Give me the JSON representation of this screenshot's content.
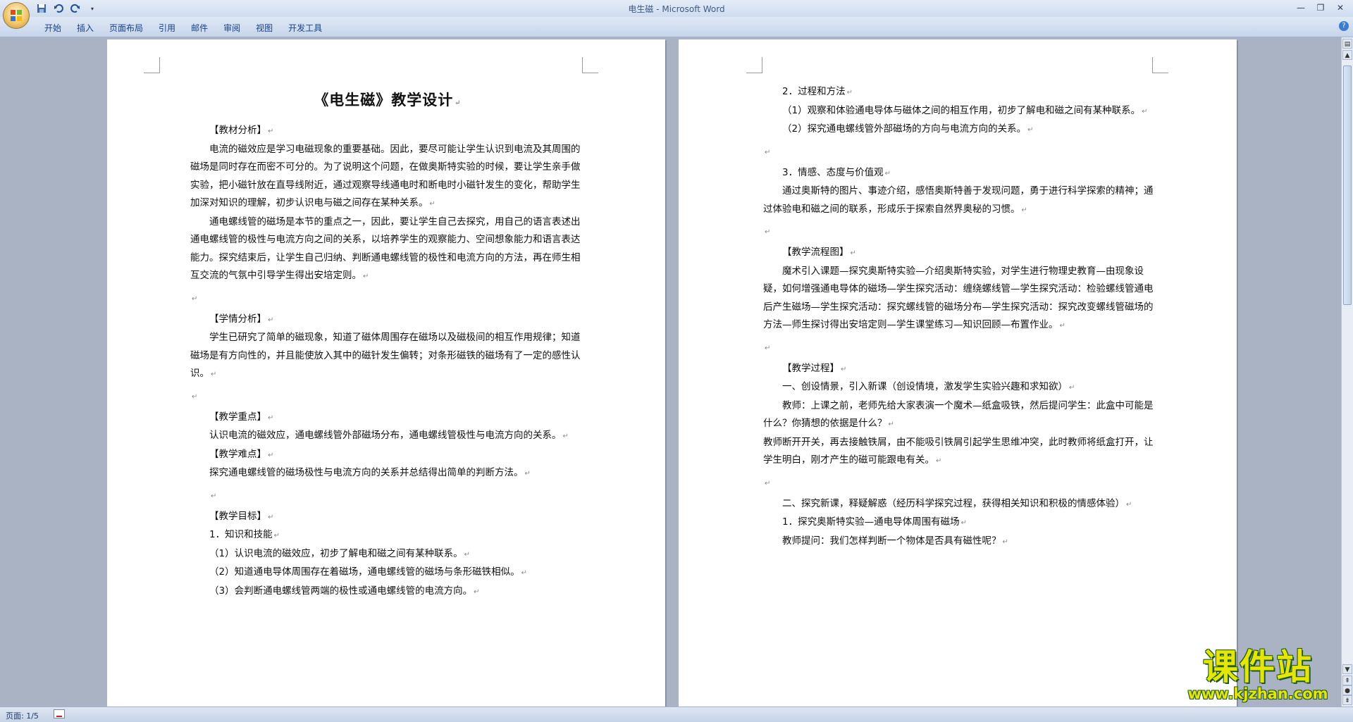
{
  "window": {
    "doc_name": "电生磁",
    "app_name": "Microsoft Word",
    "separator": " - "
  },
  "ribbon": {
    "tabs": [
      "开始",
      "插入",
      "页面布局",
      "引用",
      "邮件",
      "审阅",
      "视图",
      "开发工具"
    ]
  },
  "icons": {
    "office_button": "office-logo-icon",
    "save": "save-icon",
    "undo": "undo-icon",
    "redo": "redo-icon",
    "customize": "qat-dropdown-icon",
    "help": "help-icon"
  },
  "page1": {
    "title": "《电生磁》教学设计",
    "h_material": "【教材分析】",
    "p_material_1": "电流的磁效应是学习电磁现象的重要基础。因此，要尽可能让学生认识到电流及其周围的磁场是同时存在而密不可分的。为了说明这个问题，在做奥斯特实验的时候，要让学生亲手做实验，把小磁针放在直导线附近，通过观察导线通电时和断电时小磁针发生的变化，帮助学生加深对知识的理解，初步认识电与磁之间存在某种关系。",
    "p_material_2": "通电螺线管的磁场是本节的重点之一，因此，要让学生自己去探究，用自己的语言表述出通电螺线管的极性与电流方向之间的关系，以培养学生的观察能力、空间想象能力和语言表达能力。探究结束后，让学生自己归纳、判断通电螺线管的极性和电流方向的方法，再在师生相互交流的气氛中引导学生得出安培定则。",
    "h_students": "【学情分析】",
    "p_students": "学生已研究了简单的磁现象，知道了磁体周围存在磁场以及磁极间的相互作用规律；知道磁场是有方向性的，并且能使放入其中的磁针发生偏转；对条形磁铁的磁场有了一定的感性认识。",
    "h_key": "【教学重点】",
    "p_key": "认识电流的磁效应，通电螺线管外部磁场分布，通电螺线管极性与电流方向的关系。",
    "h_difficult": "【教学难点】",
    "p_difficult": "探究通电螺线管的磁场极性与电流方向的关系并总结得出简单的判断方法。",
    "h_goals": "【教学目标】",
    "g1": "1．知识和技能",
    "g1_1": "（1）认识电流的磁效应，初步了解电和磁之间有某种联系。",
    "g1_2": "（2）知道通电导体周围存在着磁场，通电螺线管的磁场与条形磁铁相似。",
    "g1_3": "（3）会判断通电螺线管两端的极性或通电螺线管的电流方向。"
  },
  "page2": {
    "g2": "2．过程和方法",
    "g2_1": "（1）观察和体验通电导体与磁体之间的相互作用，初步了解电和磁之间有某种联系。",
    "g2_2": "（2）探究通电螺线管外部磁场的方向与电流方向的关系。",
    "g3": "3．情感、态度与价值观",
    "p_values": "通过奥斯特的图片、事迹介绍，感悟奥斯特善于发现问题，勇于进行科学探索的精神；通过体验电和磁之间的联系，形成乐于探索自然界奥秘的习惯。",
    "h_flow": "【教学流程图】",
    "p_flow": "魔术引入课题—探究奥斯特实验—介绍奥斯特实验，对学生进行物理史教育—由现象设疑，如何增强通电导体的磁场—学生探究活动：缠绕螺线管—学生探究活动：检验螺线管通电后产生磁场—学生探究活动：探究螺线管的磁场分布—学生探究活动：探究改变螺线管磁场的方法—师生探讨得出安培定则—学生课堂练习—知识回顾—布置作业。",
    "h_process": "【教学过程】",
    "s1": "一、创设情景，引入新课（创设情境，激发学生实验兴趣和求知欲）",
    "s1_p1": "教师：上课之前，老师先给大家表演一个魔术—纸盒吸铁，然后提问学生：此盒中可能是什么？你猜想的依据是什么？",
    "s1_p2": "教师断开开关，再去接触铁屑，由不能吸引铁屑引起学生思维冲突，此时教师将纸盒打开，让学生明白，刚才产生的磁可能跟电有关。",
    "s2": "二、探究新课，释疑解惑（经历科学探究过程，获得相关知识和积极的情感体验）",
    "s2_1": "1．探究奥斯特实验—通电导体周围有磁场",
    "s2_p1": "教师提问：我们怎样判断一个物体是否具有磁性呢？"
  },
  "status": {
    "page_indicator": "页面: 1/5"
  },
  "watermark": {
    "main": "课件站",
    "url": "www.kjzhan.com"
  }
}
